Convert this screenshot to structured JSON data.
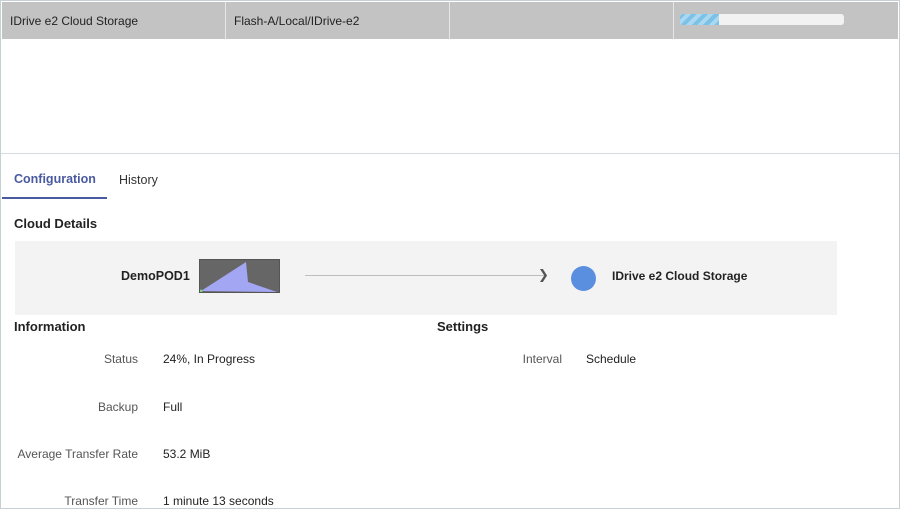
{
  "top_row": {
    "name": "IDrive e2 Cloud Storage",
    "path": "Flash-A/Local/IDrive-e2",
    "empty": "",
    "progress_pct": 24
  },
  "tabs": [
    {
      "label": "Configuration",
      "active": true
    },
    {
      "label": "History",
      "active": false
    }
  ],
  "cloud_details": {
    "title": "Cloud Details",
    "source": "DemoPOD1",
    "destination": "IDrive e2 Cloud Storage",
    "destination_color": "#5a8fe0"
  },
  "information": {
    "title": "Information",
    "rows": [
      {
        "label": "Status",
        "value": "24%, In Progress"
      },
      {
        "label": "Backup",
        "value": "Full"
      },
      {
        "label": "Average Transfer Rate",
        "value": "53.2 MiB"
      },
      {
        "label": "Transfer Time",
        "value": "1 minute 13 seconds"
      }
    ]
  },
  "settings": {
    "title": "Settings",
    "rows": [
      {
        "label": "Interval",
        "value": "Schedule"
      }
    ]
  },
  "colors": {
    "accent": "#4a5aa0",
    "row_bg": "#c3c3c3",
    "progress": "#7cc1e6"
  }
}
